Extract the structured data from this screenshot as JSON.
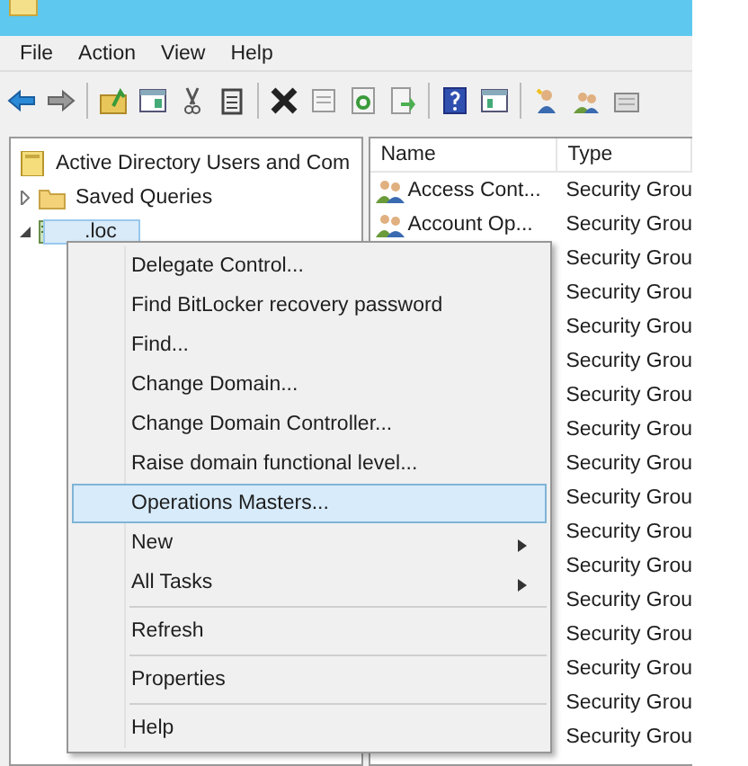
{
  "menu_bar": [
    "File",
    "Action",
    "View",
    "Help"
  ],
  "tree": [
    {
      "label": "Active Directory Users and Com",
      "kind": "root",
      "selected": false,
      "children": [
        {
          "label": "Saved Queries",
          "kind": "folder",
          "expanded": false,
          "selected": false
        },
        {
          "label": ".loc",
          "kind": "domain",
          "expanded": true,
          "selected": true
        }
      ]
    }
  ],
  "list": {
    "columns": [
      "Name",
      "Type"
    ],
    "rows": [
      {
        "name": "Access Cont...",
        "type": "Security Grou"
      },
      {
        "name": "Account Op...",
        "type": "Security Grou"
      },
      {
        "type": "Security Grou"
      },
      {
        "type": "Security Grou"
      },
      {
        "type": "Security Grou"
      },
      {
        "type": "Security Grou"
      },
      {
        "type": "Security Grou"
      },
      {
        "type": "Security Grou"
      },
      {
        "type": "Security Grou"
      },
      {
        "type": "Security Grou"
      },
      {
        "type": "Security Grou"
      },
      {
        "type": "Security Grou"
      },
      {
        "type": "Security Grou"
      },
      {
        "type": "Security Grou"
      },
      {
        "type": "Security Grou"
      },
      {
        "type": "Security Grou"
      },
      {
        "type": "Security Grou"
      }
    ]
  },
  "context_menu": [
    {
      "label": "Delegate Control...",
      "selected": false,
      "submenu": false,
      "separator_after": false
    },
    {
      "label": "Find BitLocker recovery password",
      "selected": false,
      "submenu": false,
      "separator_after": false
    },
    {
      "label": "Find...",
      "selected": false,
      "submenu": false,
      "separator_after": false
    },
    {
      "label": "Change Domain...",
      "selected": false,
      "submenu": false,
      "separator_after": false
    },
    {
      "label": "Change Domain Controller...",
      "selected": false,
      "submenu": false,
      "separator_after": false
    },
    {
      "label": "Raise domain functional level...",
      "selected": false,
      "submenu": false,
      "separator_after": false
    },
    {
      "label": "Operations Masters...",
      "selected": true,
      "submenu": false,
      "separator_after": false
    },
    {
      "label": "New",
      "selected": false,
      "submenu": true,
      "separator_after": false
    },
    {
      "label": "All Tasks",
      "selected": false,
      "submenu": true,
      "separator_after": true
    },
    {
      "label": "Refresh",
      "selected": false,
      "submenu": false,
      "separator_after": true
    },
    {
      "label": "Properties",
      "selected": false,
      "submenu": false,
      "separator_after": true
    },
    {
      "label": "Help",
      "selected": false,
      "submenu": false,
      "separator_after": false
    }
  ]
}
